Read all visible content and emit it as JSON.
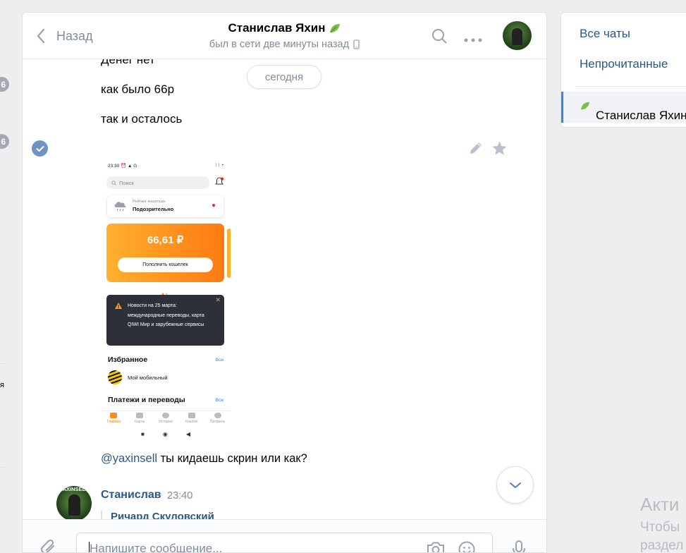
{
  "left_edge": {
    "badge_1": "6",
    "badge_2": "6",
    "fragment": "я"
  },
  "header": {
    "back_label": "Назад",
    "peer_name": "Станислав Яхин",
    "peer_status": "был в сети две минуты назад"
  },
  "history": {
    "date_divider": "сегодня",
    "messages": [
      {
        "text": "Денег нет"
      },
      {
        "text": "как было 66р"
      },
      {
        "text": "так и осталось"
      }
    ],
    "screenshot": {
      "status_time": "23:30",
      "status_icons": "⏰ ▲ G",
      "status_right": "⁞ ⁞ ◔",
      "search_placeholder": "Поиск",
      "rating_label": "Рейтинг кошелька",
      "rating_value": "Подозрительно",
      "balance": "66,61 ₽",
      "topup_button": "Пополнить кошелек",
      "news_text": "Новости на 25 марта: международные переводы, карта QIWI Мир и зарубежные сервисы",
      "favorites_title": "Избранное",
      "favorites_all": "Все",
      "favorite_item": "Мой мобильный",
      "payments_title": "Платежи и переводы",
      "payments_all": "Все",
      "tabs": [
        "Главная",
        "Карты",
        "История",
        "Кешбэк",
        "Профиль"
      ]
    },
    "mention": "@yaxinsell",
    "mention_text": " ты кидаешь скрин или как?",
    "next_author": "Станислав",
    "next_time": "23:40",
    "avatar_tag": "YAXINSELL",
    "reply_author": "Ричард Скуловский"
  },
  "composer": {
    "placeholder": "Напишите сообщение..."
  },
  "menu": {
    "all_chats": "Все чаты",
    "unread": "Непрочитанные",
    "active_chat": "Станислав Яхин"
  },
  "watermark": {
    "line1": "Акти",
    "line2": "Чтобы",
    "line3": "раздел"
  },
  "colors": {
    "link": "#2a5885",
    "accent": "#5181b8",
    "wallet": "#ff7a11"
  }
}
